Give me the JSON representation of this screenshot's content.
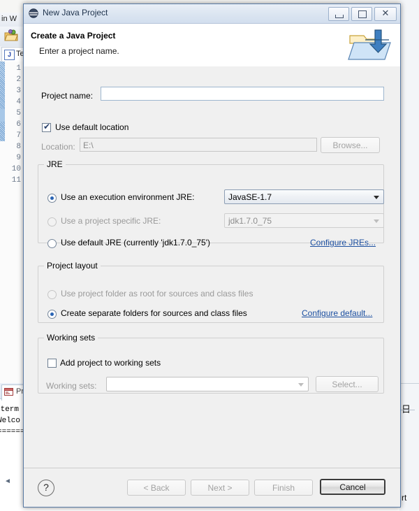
{
  "ide": {
    "menu_text": "in   W",
    "toolbar_icon": "open-folder-icon",
    "editor_tab": {
      "label": "Te",
      "icon": "java-file-icon"
    },
    "gutter_lines": [
      "1",
      "2",
      "3",
      "4",
      "5",
      "6",
      "7",
      "8",
      "9",
      "10",
      "11"
    ],
    "fold_marker": "2",
    "console_tab": {
      "label": "Pr",
      "icon": "console-icon"
    },
    "console_lines": [
      "xterm",
      "Welco",
      "======"
    ],
    "right_text": "日",
    "right_bottom_text": "rt"
  },
  "dialog": {
    "title": "New Java Project",
    "title_icon": "java-wizard-icon",
    "window_buttons": {
      "minimize": "minimize-button",
      "maximize": "maximize-button",
      "close": "close-button",
      "close_glyph": "✕"
    },
    "header": {
      "heading": "Create a Java Project",
      "subheading": "Enter a project name.",
      "banner_icon": "new-java-project-banner-icon"
    },
    "project_name": {
      "label": "Project name:",
      "value": "",
      "placeholder": ""
    },
    "use_default_location": {
      "label": "Use default location",
      "checked": true,
      "tick": "✔"
    },
    "location": {
      "label": "Location:",
      "value": "E:\\",
      "browse_label": "Browse...",
      "enabled": false
    },
    "jre_group": {
      "title": "JRE",
      "options": [
        {
          "label": "Use an execution environment JRE:",
          "selected": true,
          "enabled": true
        },
        {
          "label": "Use a project specific JRE:",
          "selected": false,
          "enabled": false
        },
        {
          "label": "Use default JRE (currently 'jdk1.7.0_75')",
          "selected": false,
          "enabled": true
        }
      ],
      "execution_env_combo": {
        "value": "JavaSE-1.7",
        "enabled": true
      },
      "specific_jre_combo": {
        "value": "jdk1.7.0_75",
        "enabled": false
      },
      "configure_link": "Configure JREs..."
    },
    "layout_group": {
      "title": "Project layout",
      "options": [
        {
          "label": "Use project folder as root for sources and class files",
          "selected": false,
          "enabled": false
        },
        {
          "label": "Create separate folders for sources and class files",
          "selected": true,
          "enabled": true
        }
      ],
      "configure_link": "Configure default..."
    },
    "working_sets_group": {
      "title": "Working sets",
      "add_checkbox": {
        "label": "Add project to working sets",
        "checked": false
      },
      "working_sets_label": "Working sets:",
      "working_sets_value": "",
      "select_label": "Select..."
    },
    "footer": {
      "help_glyph": "?",
      "buttons": [
        {
          "label": "< Back",
          "enabled": false,
          "default": false
        },
        {
          "label": "Next >",
          "enabled": false,
          "default": false
        },
        {
          "label": "Finish",
          "enabled": false,
          "default": false
        },
        {
          "label": "Cancel",
          "enabled": true,
          "default": true
        }
      ]
    }
  },
  "colors": {
    "dialog_bg": "#f0f0f0",
    "title_bar": "#dbe5f1",
    "link": "#1c4fa0",
    "radio_accent": "#2a64b4"
  }
}
